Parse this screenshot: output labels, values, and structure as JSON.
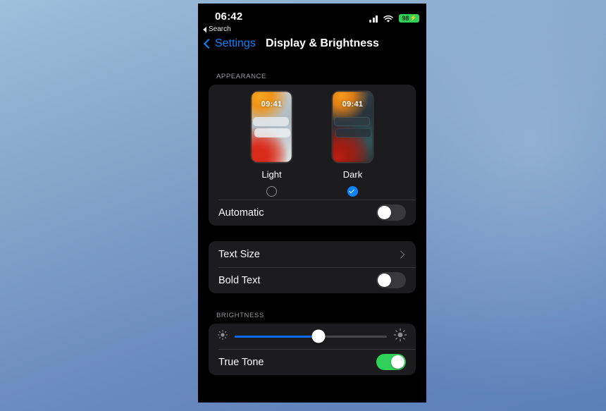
{
  "status_bar": {
    "time": "06:42",
    "back_label": "Search",
    "battery_level": "98",
    "battery_charging": true,
    "battery_color": "#30d158",
    "cellular_icon": "cellular-bars-icon",
    "wifi_icon": "wifi-icon"
  },
  "nav": {
    "back_label": "Settings",
    "title": "Display & Brightness",
    "accent_color": "#0a84ff"
  },
  "appearance": {
    "section_title": "APPEARANCE",
    "options": [
      {
        "label": "Light",
        "selected": false,
        "preview_time": "09:41"
      },
      {
        "label": "Dark",
        "selected": true,
        "preview_time": "09:41"
      }
    ],
    "automatic": {
      "label": "Automatic",
      "enabled": false
    }
  },
  "text_section": {
    "text_size": {
      "label": "Text Size",
      "disclosure_icon": "chevron-right-icon"
    },
    "bold_text": {
      "label": "Bold Text",
      "enabled": false
    }
  },
  "brightness": {
    "section_title": "BRIGHTNESS",
    "slider": {
      "value_percent": 55,
      "min_icon": "brightness-low-icon",
      "max_icon": "brightness-high-icon",
      "fill_color": "#0a6cf0"
    },
    "true_tone": {
      "label": "True Tone",
      "enabled": true,
      "on_color": "#30d158"
    }
  }
}
